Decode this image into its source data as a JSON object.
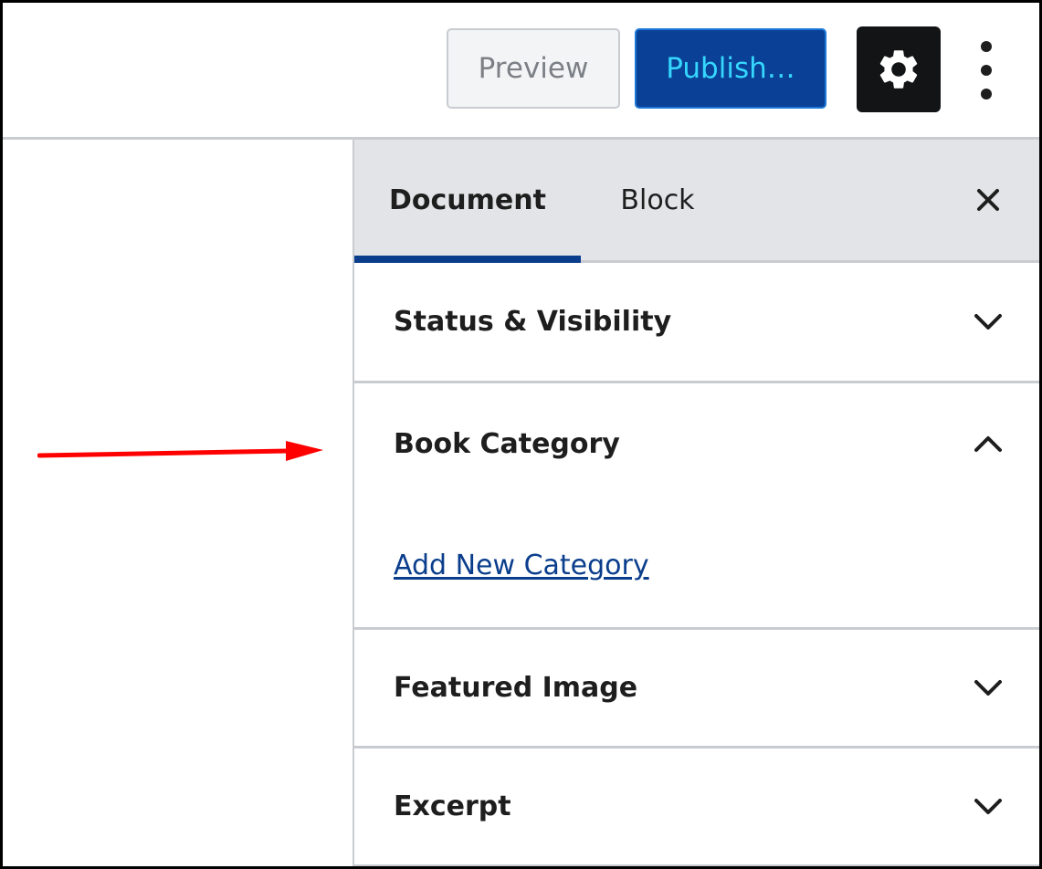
{
  "toolbar": {
    "preview_label": "Preview",
    "publish_label": "Publish…",
    "settings_icon": "gear-icon",
    "more_icon": "kebab-menu-icon"
  },
  "sidebar": {
    "tabs": [
      {
        "label": "Document",
        "active": true
      },
      {
        "label": "Block",
        "active": false
      }
    ],
    "close_icon": "close-icon",
    "panels": [
      {
        "title": "Status & Visibility",
        "expanded": false
      },
      {
        "title": "Book Category",
        "expanded": true,
        "link": "Add New Category"
      },
      {
        "title": "Featured Image",
        "expanded": false
      },
      {
        "title": "Excerpt",
        "expanded": false
      }
    ]
  },
  "annotation": {
    "type": "arrow",
    "color": "#ff0000",
    "direction": "right"
  },
  "colors": {
    "publish_bg": "#0a4095",
    "publish_text": "#35d7ff",
    "settings_bg": "#121416",
    "accent": "#0a3e8c",
    "tabbar_bg": "#e2e4e7",
    "border": "#c8ccd1"
  }
}
